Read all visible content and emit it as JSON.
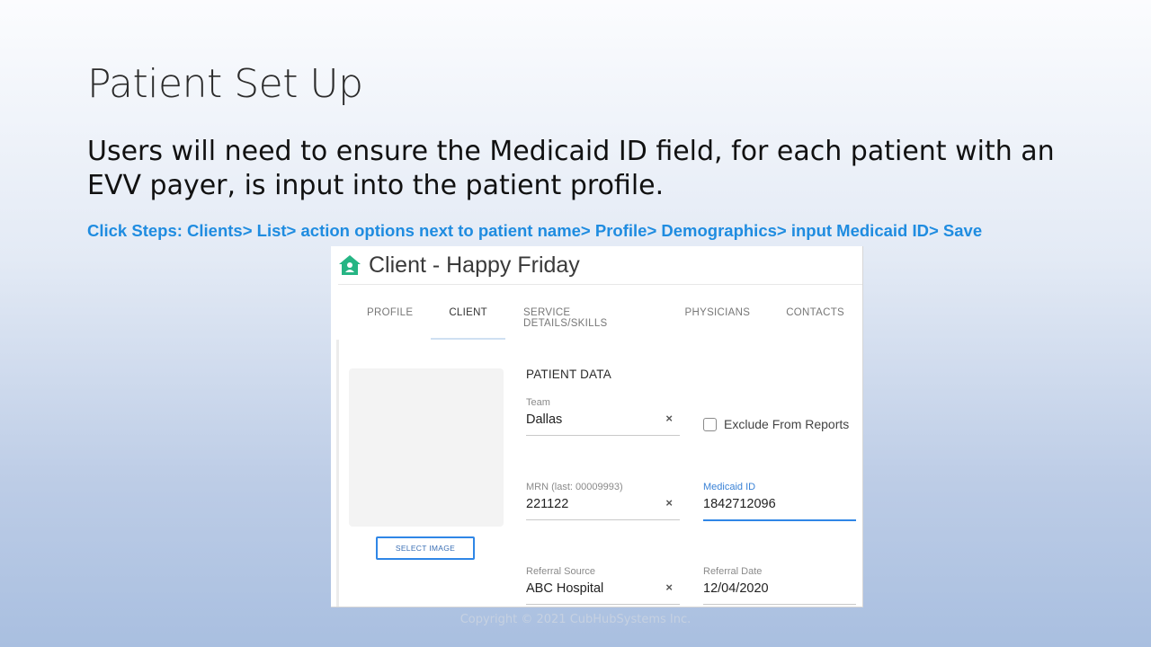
{
  "slide": {
    "title": "Patient Set Up",
    "body": "Users will need to ensure the Medicaid ID field, for each patient with an EVV payer, is input into the patient profile.",
    "click_steps": "Click Steps: Clients> List> action options next to patient name> Profile> Demographics> input Medicaid ID> Save",
    "copyright": "Copyright © 2021 CubHubSystems Inc."
  },
  "app": {
    "title": "Client - Happy Friday",
    "title_icon": "home-icon",
    "accent_color": "#26b584",
    "tabs": [
      {
        "label": "PROFILE"
      },
      {
        "label": "CLIENT"
      },
      {
        "label": "SERVICE DETAILS/SKILLS"
      },
      {
        "label": "PHYSICIANS"
      },
      {
        "label": "CONTACTS"
      }
    ],
    "select_image_label": "SELECT IMAGE",
    "section_heading": "PATIENT DATA",
    "fields": {
      "team": {
        "label": "Team",
        "value": "Dallas"
      },
      "exclude": {
        "label": "Exclude From Reports",
        "checked": false
      },
      "mrn": {
        "label": "MRN (last: 00009993)",
        "value": "221122"
      },
      "medicaid": {
        "label": "Medicaid ID",
        "value": "1842712096"
      },
      "referral_source": {
        "label": "Referral Source",
        "value": "ABC Hospital"
      },
      "referral_date": {
        "label": "Referral Date",
        "value": "12/04/2020"
      }
    },
    "clear_glyph": "×"
  }
}
